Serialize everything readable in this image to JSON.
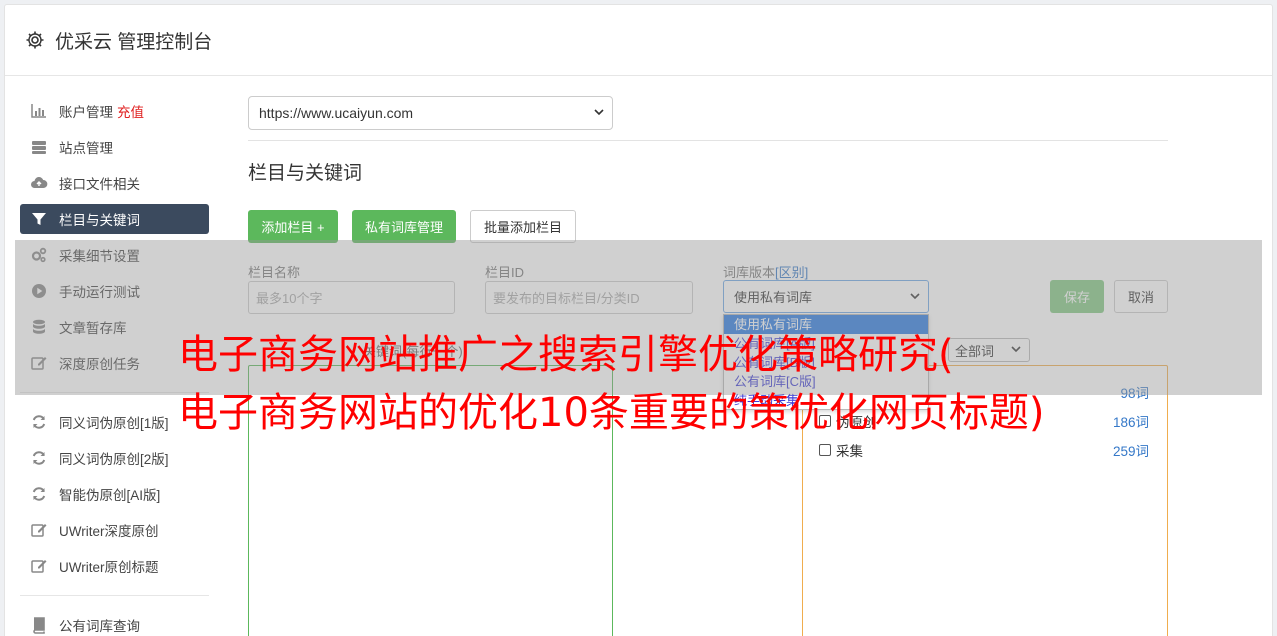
{
  "app": {
    "title": "优采云 管理控制台",
    "icon": "gear-icon"
  },
  "sidebar": {
    "group1": [
      {
        "label": "账户管理",
        "extra": "充值",
        "icon": "bar-chart-icon"
      },
      {
        "label": "站点管理",
        "icon": "server-icon"
      },
      {
        "label": "接口文件相关",
        "icon": "cloud-upload-icon"
      },
      {
        "label": "栏目与关键词",
        "icon": "filter-icon",
        "active": true
      },
      {
        "label": "采集细节设置",
        "icon": "cogs-icon"
      },
      {
        "label": "手动运行测试",
        "icon": "play-circle-icon"
      },
      {
        "label": "文章暂存库",
        "icon": "database-icon"
      },
      {
        "label": "深度原创任务",
        "icon": "edit-icon"
      }
    ],
    "group2": [
      {
        "label": "同义词伪原创[1版]",
        "icon": "refresh-icon"
      },
      {
        "label": "同义词伪原创[2版]",
        "icon": "refresh-icon"
      },
      {
        "label": "智能伪原创[AI版]",
        "icon": "refresh-icon"
      },
      {
        "label": "UWriter深度原创",
        "icon": "edit-icon"
      },
      {
        "label": "UWriter原创标题",
        "icon": "edit-icon"
      }
    ],
    "group3": [
      {
        "label": "公有词库查询",
        "icon": "book-icon"
      }
    ]
  },
  "main": {
    "site_select": "https://www.ucaiyun.com",
    "section_title": "栏目与关键词",
    "buttons": {
      "add_column": "添加栏目 +",
      "private_lib": "私有词库管理",
      "batch_add": "批量添加栏目"
    },
    "form": {
      "name_label": "栏目名称",
      "name_placeholder": "最多10个字",
      "id_label": "栏目ID",
      "id_placeholder": "要发布的目标栏目/分类ID",
      "version_label": "词库版本",
      "version_hint": "[区别]",
      "version_value": "使用私有词库",
      "save": "保存",
      "cancel": "取消"
    },
    "dropdown_options": [
      "使用私有词库",
      "公有词库[A版]",
      "公有词库[B版]",
      "公有词库[C版]",
      "纯手动采集"
    ],
    "keywords_label": "关键词(每行一个)",
    "filter_value": "全部词",
    "keyword_rows": [
      {
        "label": "",
        "count": "98词"
      },
      {
        "label": "伪原创",
        "count": "186词"
      },
      {
        "label": "采集",
        "count": "259词"
      }
    ]
  },
  "overlay": {
    "line1": "电子商务网站推广之搜索引擎优化策略研究(",
    "line2": "电子商务网站的优化10条重要的策优化网页标题)"
  }
}
